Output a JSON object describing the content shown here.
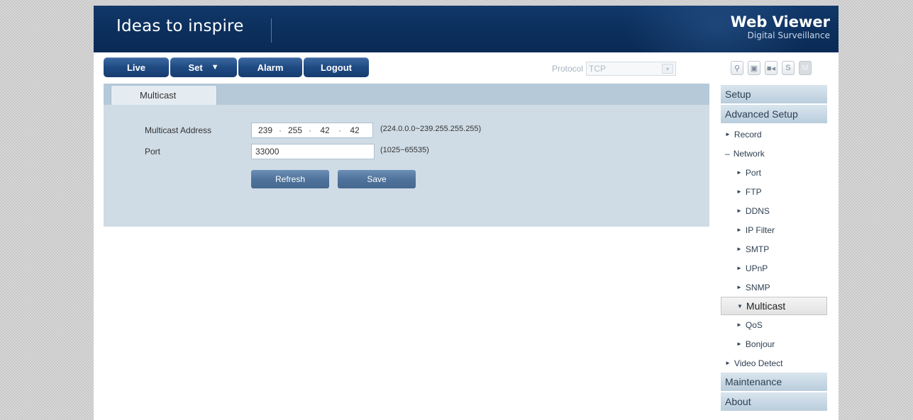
{
  "banner": {
    "tagline": "Ideas to inspire",
    "brand_title": "Web Viewer",
    "brand_subtitle": "Digital Surveillance"
  },
  "nav": {
    "live": "Live",
    "set": "Set",
    "set_caret": "▼",
    "alarm": "Alarm",
    "logout": "Logout"
  },
  "protocol": {
    "label": "Protocol",
    "value": "TCP",
    "arrow": "▾"
  },
  "toolbar_icons": [
    "search-icon",
    "snapshot-icon",
    "record-icon",
    "s-icon",
    "fullscreen-icon"
  ],
  "toolbar_glyphs": {
    "search": "⚲",
    "snapshot": "▣",
    "record": "■◂",
    "s": "S",
    "fullscreen": "M"
  },
  "tab": {
    "label": "Multicast"
  },
  "form": {
    "address_label": "Multicast Address",
    "address": [
      "239",
      "255",
      "42",
      "42"
    ],
    "dot": "·",
    "address_hint": "(224.0.0.0~239.255.255.255)",
    "port_label": "Port",
    "port_value": "33000",
    "port_hint": "(1025~65535)",
    "refresh": "Refresh",
    "save": "Save"
  },
  "sidebar": {
    "setup": "Setup",
    "advanced": "Advanced Setup",
    "items": [
      {
        "label": "Record",
        "marker": "►"
      },
      {
        "label": "Network",
        "marker": "–"
      },
      {
        "label": "Port",
        "marker": "►"
      },
      {
        "label": "FTP",
        "marker": "►"
      },
      {
        "label": "DDNS",
        "marker": "►"
      },
      {
        "label": "IP Filter",
        "marker": "►"
      },
      {
        "label": "SMTP",
        "marker": "►"
      },
      {
        "label": "UPnP",
        "marker": "►"
      },
      {
        "label": "SNMP",
        "marker": "►"
      },
      {
        "label": "Multicast",
        "marker": "▼"
      },
      {
        "label": "QoS",
        "marker": "►"
      },
      {
        "label": "Bonjour",
        "marker": "►"
      },
      {
        "label": "Video Detect",
        "marker": "►"
      }
    ],
    "maintenance": "Maintenance",
    "about": "About"
  }
}
